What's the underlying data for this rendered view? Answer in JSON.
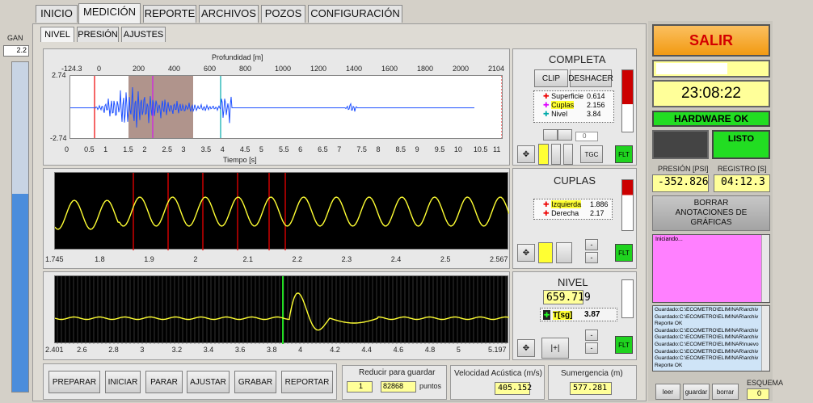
{
  "tabs": [
    "INICIO",
    "MEDICIÓN",
    "REPORTE",
    "ARCHIVOS",
    "POZOS",
    "CONFIGURACIÓN"
  ],
  "subtabs": [
    "NIVEL",
    "PRESIÓN",
    "AJUSTES"
  ],
  "gain": {
    "label": "GAN",
    "value": "2.2",
    "level_fraction": 0.6
  },
  "plot1": {
    "title_top": "Profundidad [m]",
    "title_bottom": "Tiempo [s]",
    "y_max": "2.74",
    "y_min": "-2.74",
    "top_ticks": [
      "-124.3",
      "0",
      "200",
      "400",
      "600",
      "800",
      "1000",
      "1200",
      "1400",
      "1600",
      "1800",
      "2000",
      "2104"
    ],
    "bottom_ticks": [
      "0",
      "0.5",
      "1",
      "1.5",
      "2",
      "2.5",
      "3",
      "3.5",
      "4",
      "4.5",
      "5",
      "5.5",
      "6",
      "6.5",
      "7",
      "7.5",
      "8",
      "8.5",
      "9",
      "9.5",
      "10",
      "10.5",
      "11"
    ]
  },
  "plot2": {
    "ticks": [
      "1.745",
      "1.8",
      "1.9",
      "2",
      "2.1",
      "2.2",
      "2.3",
      "2.4",
      "2.5",
      "2.567"
    ]
  },
  "plot3": {
    "ticks": [
      "2.401",
      "2.6",
      "2.8",
      "3",
      "3.2",
      "3.4",
      "3.6",
      "3.8",
      "4",
      "4.2",
      "4.4",
      "4.6",
      "4.8",
      "5",
      "5.197"
    ]
  },
  "completa": {
    "title": "COMPLETA",
    "clip": "CLIP",
    "deshacer": "DESHACER",
    "legend": [
      {
        "name": "Superficie",
        "value": "0.614"
      },
      {
        "name": "Cuplas",
        "value": "2.156"
      },
      {
        "name": "Nivel",
        "value": "3.84"
      }
    ],
    "spin_value": "0",
    "tgc": "TGC",
    "flt": "FLT"
  },
  "cuplas": {
    "title": "CUPLAS",
    "legend": [
      {
        "name": "Izquierda",
        "value": "1.886"
      },
      {
        "name": "Derecha",
        "value": "2.17"
      }
    ],
    "flt": "FLT"
  },
  "nivel": {
    "title": "NIVEL",
    "value": "659.719",
    "t_label": "T[sg]",
    "t_value": "3.87",
    "cursor_btn": "|+|",
    "flt": "FLT"
  },
  "bottom_buttons": [
    "PREPARAR",
    "INICIAR",
    "PARAR",
    "AJUSTAR",
    "GRABAR",
    "REPORTAR"
  ],
  "reducir": {
    "label": "Reducir para guardar",
    "spin": "1",
    "value": "82868",
    "unit": "puntos"
  },
  "velocidad": {
    "label": "Velocidad Acústica (m/s)",
    "value": "405.152"
  },
  "sumergencia": {
    "label": "Sumergencia (m)",
    "value": "577.281"
  },
  "right": {
    "salir": "SALIR",
    "clock": "23:08:22",
    "hardware": "HARDWARE OK",
    "listo": "LISTO",
    "presion_label": "PRESIÓN [PSI]",
    "registro_label": "REGISTRO [S]",
    "presion_value": "-352.826",
    "registro_value": "04:12.3",
    "borrar": "BORRAR ANOTACIONES DE GRÁFICAS",
    "status_text": "Iniciando...",
    "log": [
      "Guardado:C:\\ECOMETRO\\ELIMINAR\\archiv",
      "Guardado:C:\\ECOMETRO\\ELIMINAR\\archiv",
      "Reporte OK",
      "Guardado:C:\\ECOMETRO\\ELIMINAR\\archiv",
      "Guardado:C:\\ECOMETRO\\ELIMINAR\\archiv",
      "Guardado:C:\\ECOMETRO\\ELIMINAR\\nuevo",
      "Guardado:C:\\ECOMETRO\\ELIMINAR\\archiv",
      "Guardado:C:\\ECOMETRO\\ELIMINAR\\archiv",
      "Reporte OK"
    ],
    "leer": "leer",
    "guardar": "guardar",
    "borrar_small": "borrar",
    "esquema_label": "ESQUEMA",
    "esquema_value": "0"
  },
  "colors": {
    "accent_orange": "#f5a623",
    "salir_text": "#d40000",
    "green": "#22dd22",
    "pink": "#ff80ff",
    "trace_blue": "#1e50ff",
    "trace_yellow": "#ffff33"
  }
}
